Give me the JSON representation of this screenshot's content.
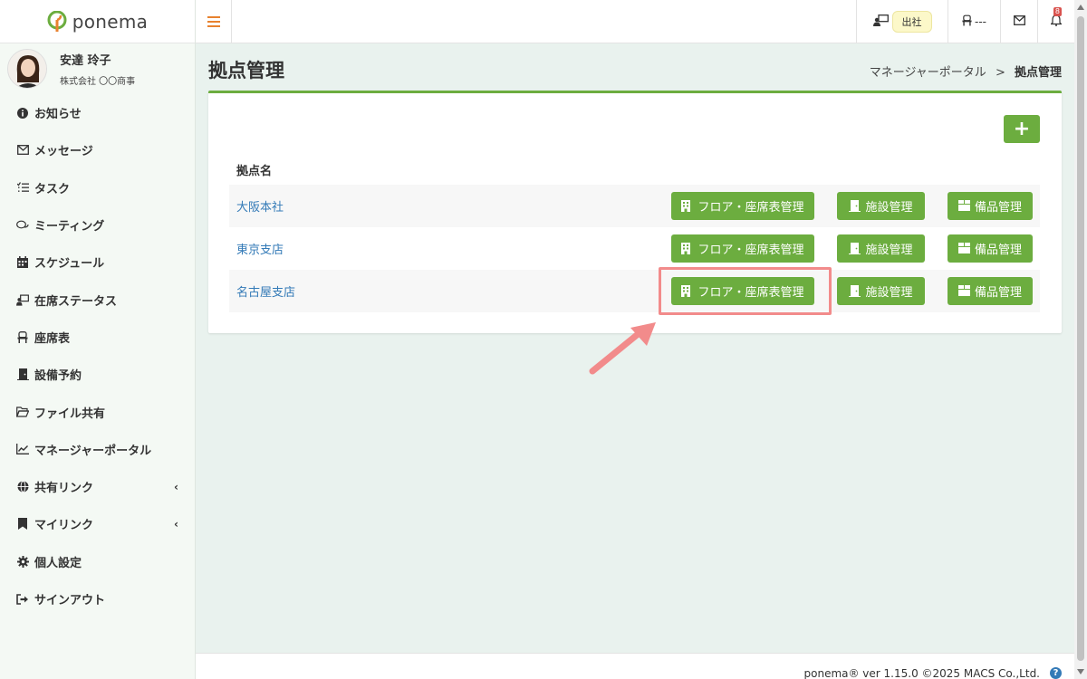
{
  "app": {
    "logo_text": "ponema"
  },
  "user": {
    "name": "安達 玲子",
    "company": "株式会社 〇〇商事"
  },
  "sidebar": {
    "items": [
      {
        "label": "お知らせ",
        "icon": "info-icon"
      },
      {
        "label": "メッセージ",
        "icon": "envelope-icon"
      },
      {
        "label": "タスク",
        "icon": "task-list-icon"
      },
      {
        "label": "ミーティング",
        "icon": "chat-icon"
      },
      {
        "label": "スケジュール",
        "icon": "calendar-icon"
      },
      {
        "label": "在席ステータス",
        "icon": "presence-icon"
      },
      {
        "label": "座席表",
        "icon": "chair-icon"
      },
      {
        "label": "設備予約",
        "icon": "door-icon"
      },
      {
        "label": "ファイル共有",
        "icon": "folder-icon"
      },
      {
        "label": "マネージャーポータル",
        "icon": "chart-icon"
      },
      {
        "label": "共有リンク",
        "icon": "globe-icon",
        "expandable": true
      },
      {
        "label": "マイリンク",
        "icon": "bookmark-icon",
        "expandable": true
      },
      {
        "label": "個人設定",
        "icon": "gear-icon"
      },
      {
        "label": "サインアウト",
        "icon": "sign-out-icon"
      }
    ]
  },
  "topbar": {
    "status_label": "出社",
    "seat_label": "---",
    "notification_count": "8"
  },
  "page": {
    "title": "拠点管理",
    "breadcrumb_parent": "マネージャーポータル",
    "breadcrumb_sep": ">",
    "breadcrumb_current": "拠点管理"
  },
  "table": {
    "column_header": "拠点名",
    "rows": [
      {
        "name": "大阪本社"
      },
      {
        "name": "東京支店"
      },
      {
        "name": "名古屋支店"
      }
    ],
    "btn_floor": "フロア・座席表管理",
    "btn_facility": "施設管理",
    "btn_equipment": "備品管理"
  },
  "add_button_label": "+",
  "footer": {
    "text": "ponema® ver 1.15.0 ©2025 MACS Co.,Ltd.",
    "help": "?"
  },
  "colors": {
    "accent": "#6cad3f",
    "link": "#337ab7",
    "highlight": "#f28b8b",
    "hamburger": "#e8822f"
  }
}
